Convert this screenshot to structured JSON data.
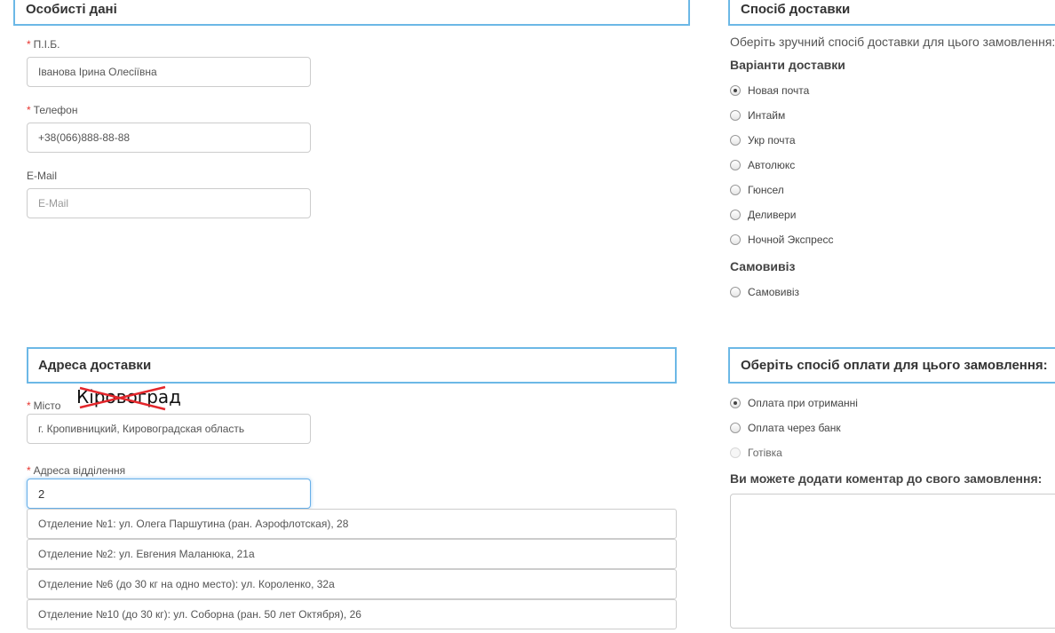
{
  "personal": {
    "title": "Особисті дані",
    "fio_label": "П.І.Б.",
    "fio_value": "Іванова Ірина Олесіївна",
    "phone_label": "Телефон",
    "phone_value": "+38(066)888-88-88",
    "email_label": "E-Mail",
    "email_placeholder": "E-Mail",
    "required_mark": "*"
  },
  "delivery": {
    "title": "Спосіб доставки",
    "intro": "Оберіть зручний спосіб доставки для цього замовлення:",
    "variants_heading": "Варіанти доставки",
    "options": [
      "Новая почта",
      "Интайм",
      "Укр почта",
      "Автолюкс",
      "Гюнсел",
      "Деливери",
      "Ночной Экспресс"
    ],
    "selected": "Новая почта",
    "pickup_heading": "Самовивіз",
    "pickup_option": "Самовивіз"
  },
  "address": {
    "title": "Адреса доставки",
    "city_label": "Місто",
    "city_value": "г. Кропивницкий, Кировоградская область",
    "branch_label": "Адреса відділення",
    "branch_value": "2",
    "suggestions": [
      "Отделение №1: ул. Олега Паршутина (ран. Аэрофлотская), 28",
      "Отделение №2: ул. Евгения Маланюка, 21а",
      "Отделение №6 (до 30 кг на одно место): ул. Короленко, 32а",
      "Отделение №10 (до 30 кг): ул. Соборна (ран. 50 лет Октября), 26"
    ],
    "annotation_text": "Кіровоград"
  },
  "payment": {
    "title": "Оберіть спосіб оплати для цього замовлення:",
    "options": [
      "Оплата при отриманні",
      "Оплата через банк",
      "Готівка"
    ],
    "selected": "Оплата при отриманні",
    "disabled": "Готівка",
    "comment_heading": "Ви можете додати коментар до свого замовлення:"
  },
  "colors": {
    "section_border": "#6cb8e6",
    "required_star": "#e8352f",
    "annotation_strike": "#e3262b"
  }
}
